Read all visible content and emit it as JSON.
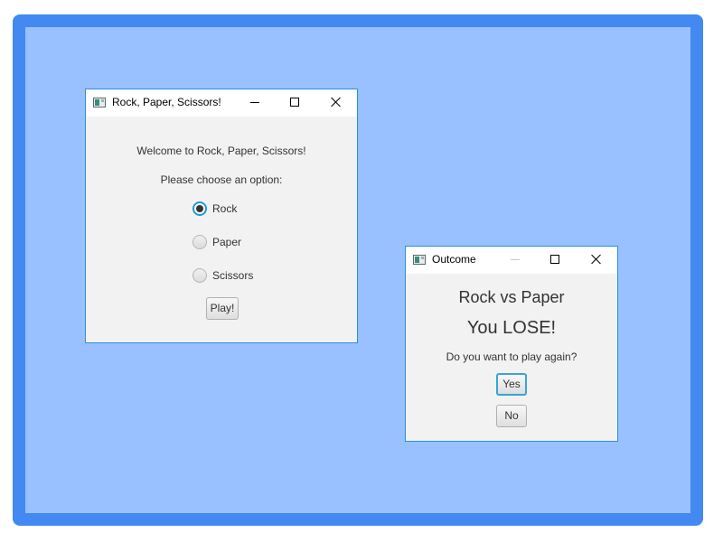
{
  "main_window": {
    "title": "Rock, Paper, Scissors!",
    "welcome": "Welcome to Rock, Paper, Scissors!",
    "prompt": "Please choose an option:",
    "options": [
      {
        "label": "Rock",
        "checked": true
      },
      {
        "label": "Paper",
        "checked": false
      },
      {
        "label": "Scissors",
        "checked": false
      }
    ],
    "play_label": "Play!"
  },
  "outcome_window": {
    "title": "Outcome",
    "matchup": "Rock vs Paper",
    "result": "You LOSE!",
    "question": "Do you want to play again?",
    "yes_label": "Yes",
    "no_label": "No"
  },
  "colors": {
    "desktop_border": "#4289f2",
    "desktop_background": "#99c0ff",
    "window_border": "#2d8fd8",
    "focus_ring": "#3aa3d8"
  },
  "icons": {
    "app": "app-window-icon",
    "minimize": "minimize-icon",
    "maximize": "maximize-icon",
    "close": "close-icon"
  }
}
